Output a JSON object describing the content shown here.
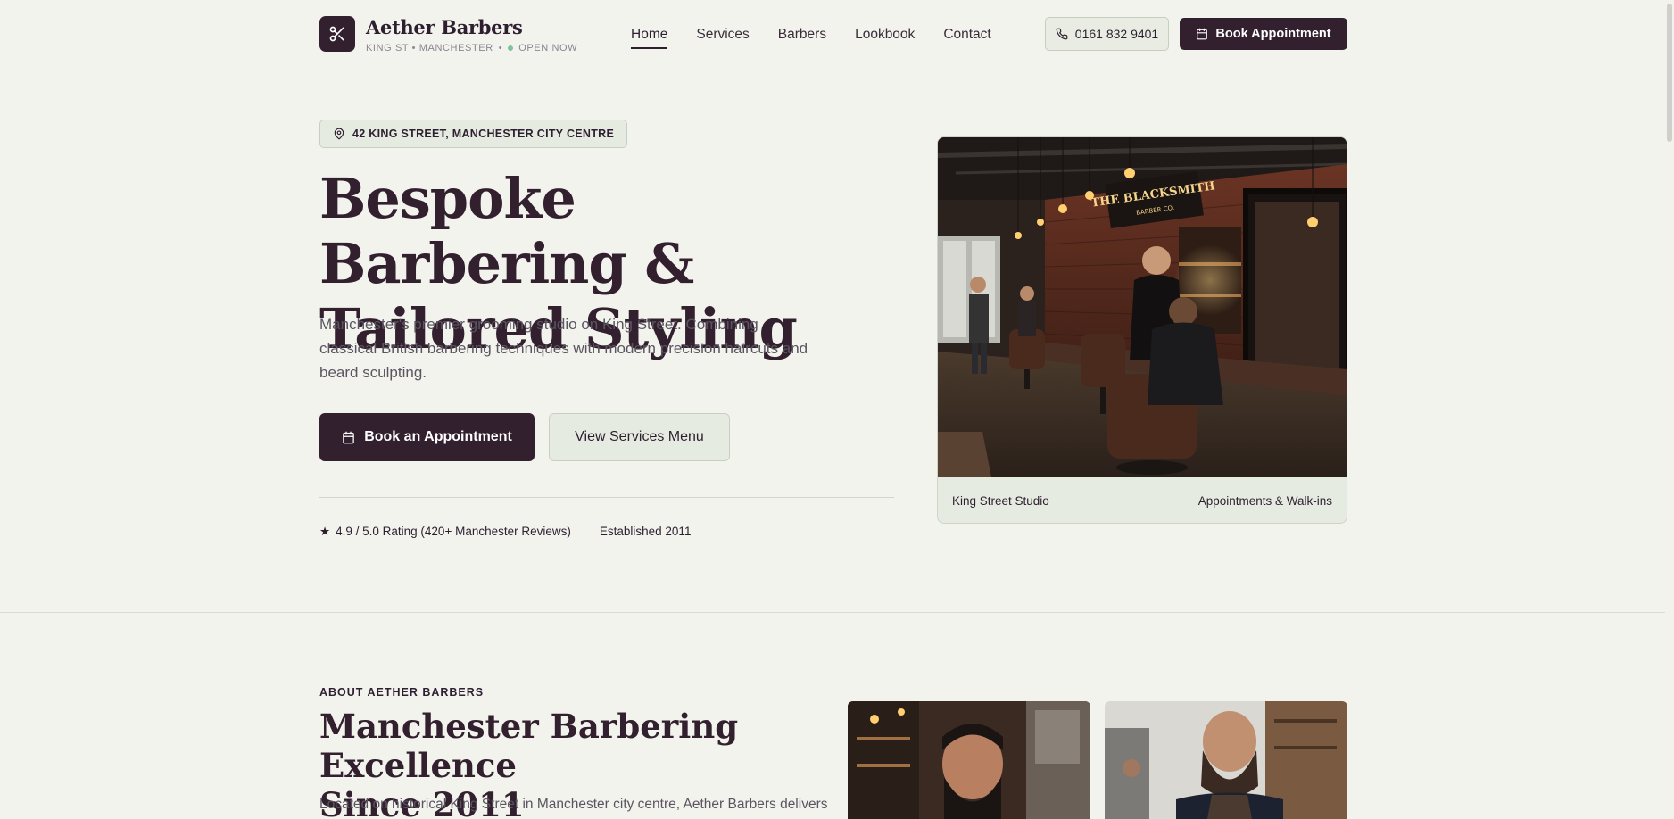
{
  "header": {
    "brand_name": "Aether Barbers",
    "brand_location": "KING ST • MANCHESTER",
    "brand_separator": "•",
    "status": "OPEN NOW",
    "nav": [
      "Home",
      "Services",
      "Barbers",
      "Lookbook",
      "Contact"
    ],
    "phone": "0161 832 9401",
    "book_label": "Book Appointment"
  },
  "hero": {
    "location": "42 KING STREET, MANCHESTER CITY CENTRE",
    "title_line1": "Bespoke Barbering &",
    "title_line2": "Tailored Styling",
    "description": "Manchester's premier grooming studio on King Street. Combining classical British barbering techniques with modern precision haircuts and beard sculpting.",
    "primary_cta": "Book an Appointment",
    "secondary_cta": "View Services Menu",
    "rating": "4.9 / 5.0 Rating (420+ Manchester Reviews)",
    "established": "Established 2011",
    "card_left": "King Street Studio",
    "card_right": "Appointments & Walk-ins",
    "sign_line1": "THE BLACKSMITH",
    "sign_line2": "BARBER CO."
  },
  "about": {
    "eyebrow": "ABOUT AETHER BARBERS",
    "title_line1": "Manchester Barbering Excellence",
    "title_line2": "Since 2011",
    "description": "Located on historical King Street in Manchester city centre, Aether Barbers delivers"
  },
  "colors": {
    "background": "#f3f3ee",
    "primary": "#33202f",
    "accent_green": "#7cc49a",
    "chip_bg": "#e6ebe1"
  },
  "icons": {
    "logo": "scissors-icon",
    "phone": "phone-icon",
    "calendar": "calendar-icon",
    "location": "map-pin-icon",
    "rating": "star-icon"
  }
}
